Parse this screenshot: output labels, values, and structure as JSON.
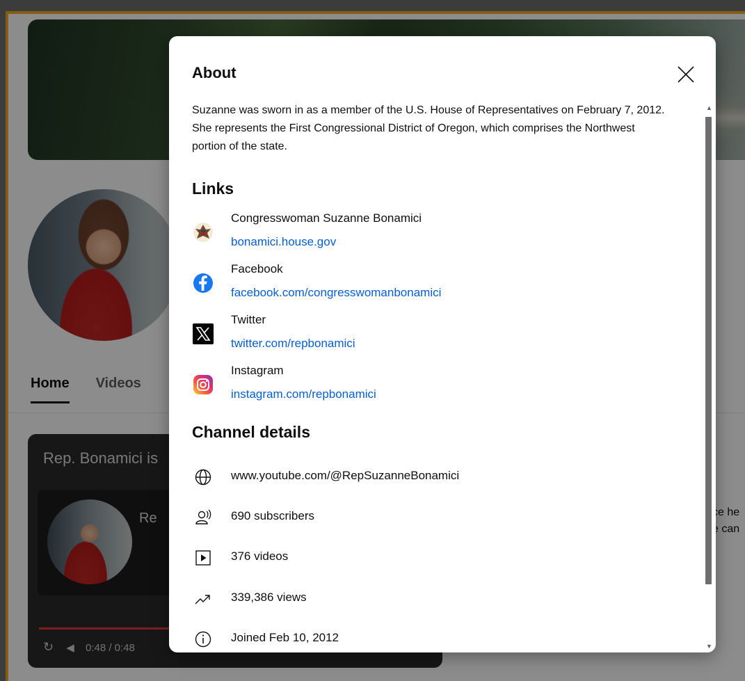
{
  "page": {
    "tabs": [
      {
        "label": "Home",
        "active": true
      },
      {
        "label": "Videos",
        "active": false
      }
    ],
    "player": {
      "title": "Rep. Bonamici is",
      "card_name": "Re",
      "time": "0:48 / 0:48"
    },
    "side_text": {
      "line1": "ce he",
      "line2": "e can"
    }
  },
  "dialog": {
    "about_heading": "About",
    "description": "Suzanne was sworn in as a member of the U.S. House of Representatives on February 7, 2012. She represents the First Congressional District of Oregon, which comprises the Northwest portion of the state.",
    "links_heading": "Links",
    "links": [
      {
        "title": "Congresswoman Suzanne Bonamici",
        "url": "bonamici.house.gov",
        "icon": "house-seal-icon"
      },
      {
        "title": "Facebook",
        "url": "facebook.com/congresswomanbonamici",
        "icon": "facebook-icon"
      },
      {
        "title": "Twitter",
        "url": "twitter.com/repbonamici",
        "icon": "x-twitter-icon"
      },
      {
        "title": "Instagram",
        "url": "instagram.com/repbonamici",
        "icon": "instagram-icon"
      }
    ],
    "details_heading": "Channel details",
    "details": [
      {
        "text": "www.youtube.com/@RepSuzanneBonamici",
        "icon": "globe-icon"
      },
      {
        "text": "690 subscribers",
        "icon": "subscribers-icon"
      },
      {
        "text": "376 videos",
        "icon": "videos-icon"
      },
      {
        "text": "339,386 views",
        "icon": "trending-icon"
      },
      {
        "text": "Joined Feb 10, 2012",
        "icon": "info-icon"
      }
    ]
  },
  "colors": {
    "link": "#065fd4",
    "frame_border": "#f5a623",
    "facebook": "#1877f2"
  }
}
